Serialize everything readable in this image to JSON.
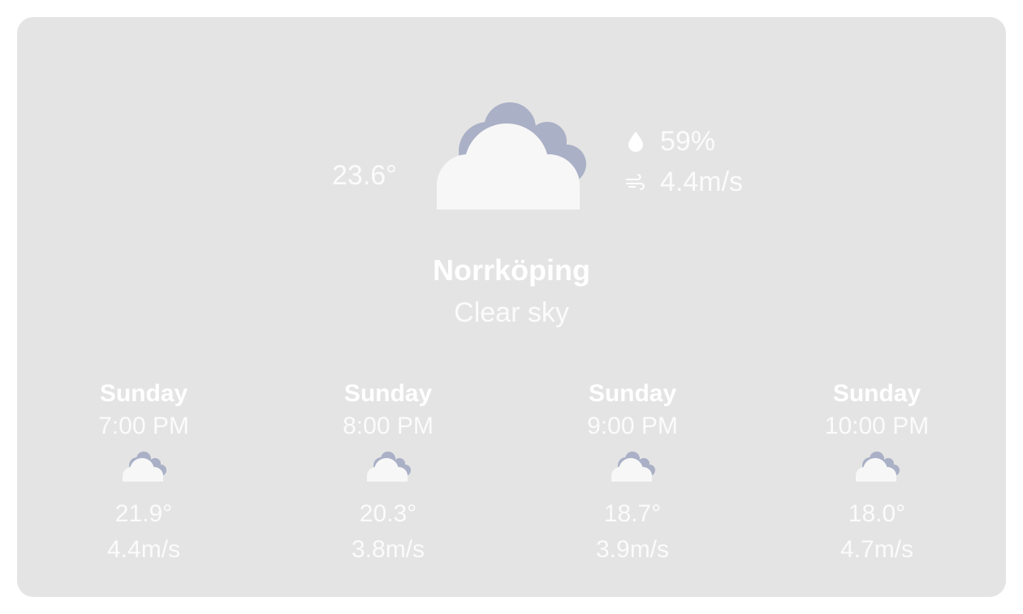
{
  "current": {
    "temperature": "23.6°",
    "humidity": "59%",
    "wind": "4.4m/s",
    "icon": "cloud-icon",
    "city": "Norrköping",
    "condition": "Clear sky"
  },
  "colors": {
    "card_bg": "#e4e4e4",
    "text": "#ffffff",
    "cloud_front": "#f7f7f7",
    "cloud_back": "#aab0c6"
  },
  "forecast": [
    {
      "day": "Sunday",
      "time": "7:00 PM",
      "icon": "cloud-icon",
      "temp": "21.9°",
      "wind": "4.4m/s"
    },
    {
      "day": "Sunday",
      "time": "8:00 PM",
      "icon": "cloud-icon",
      "temp": "20.3°",
      "wind": "3.8m/s"
    },
    {
      "day": "Sunday",
      "time": "9:00 PM",
      "icon": "cloud-icon",
      "temp": "18.7°",
      "wind": "3.9m/s"
    },
    {
      "day": "Sunday",
      "time": "10:00 PM",
      "icon": "cloud-icon",
      "temp": "18.0°",
      "wind": "4.7m/s"
    }
  ]
}
